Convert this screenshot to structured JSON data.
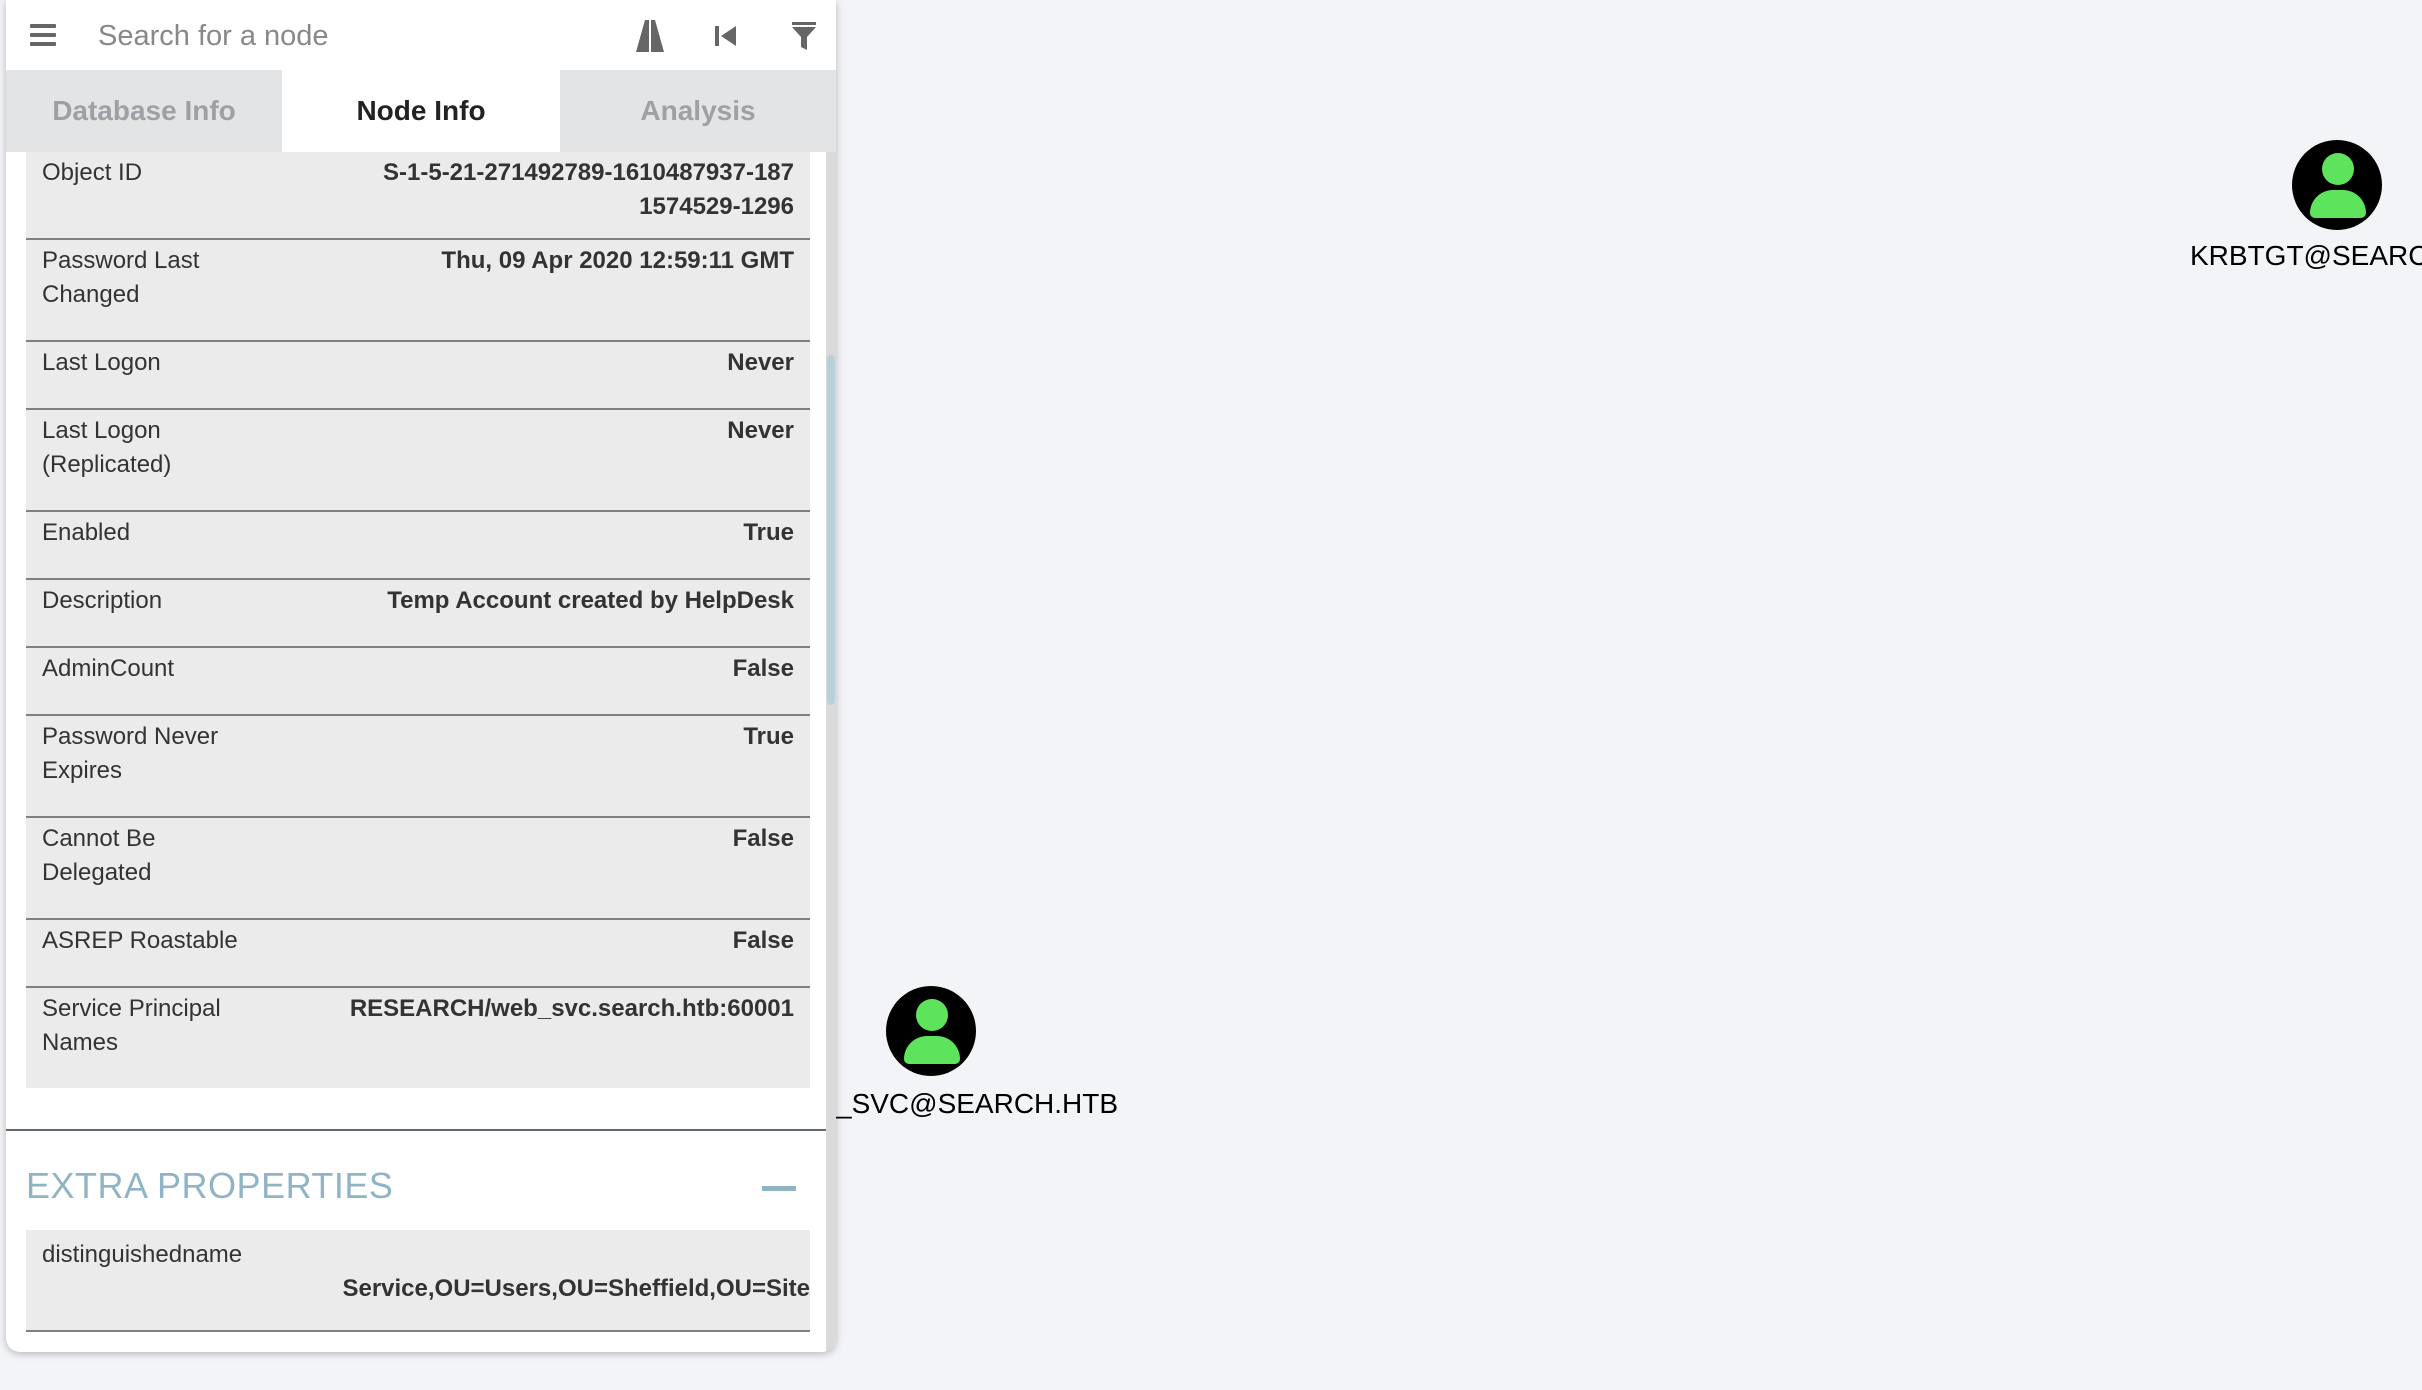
{
  "search": {
    "placeholder": "Search for a node"
  },
  "tabs": [
    {
      "label": "Database Info"
    },
    {
      "label": "Node Info"
    },
    {
      "label": "Analysis"
    }
  ],
  "properties": [
    {
      "key": "Object ID",
      "value": "S-1-5-21-271492789-1610487937-1871574529-1296"
    },
    {
      "key": "Password Last Changed",
      "value": "Thu, 09 Apr 2020 12:59:11 GMT"
    },
    {
      "key": "Last Logon",
      "value": "Never"
    },
    {
      "key": "Last Logon (Replicated)",
      "value": "Never"
    },
    {
      "key": "Enabled",
      "value": "True"
    },
    {
      "key": "Description",
      "value": "Temp Account created by HelpDesk"
    },
    {
      "key": "AdminCount",
      "value": "False"
    },
    {
      "key": "Password Never Expires",
      "value": "True"
    },
    {
      "key": "Cannot Be Delegated",
      "value": "False"
    },
    {
      "key": "ASREP Roastable",
      "value": "False"
    },
    {
      "key": "Service Principal Names",
      "value": "RESEARCH/web_svc.search.htb:60001"
    }
  ],
  "extra": {
    "title": "EXTRA PROPERTIES",
    "rows": [
      {
        "key": "distinguishedname",
        "value": "Service,OU=Users,OU=Sheffield,OU=Site"
      }
    ]
  },
  "graph": {
    "nodes": [
      {
        "label": "KRBTGT@SEARCH"
      },
      {
        "label": "_SVC@SEARCH.HTB"
      }
    ]
  },
  "colors": {
    "node_icon": "#5ee45c",
    "accent": "#8fb4c6"
  }
}
